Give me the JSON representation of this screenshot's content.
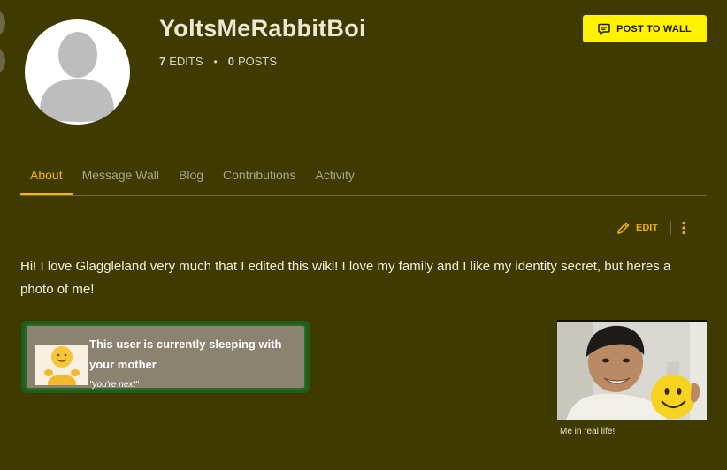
{
  "profile": {
    "username": "YoltsMeRabbitBoi",
    "edits_count": "7",
    "edits_label": "EDITS",
    "posts_count": "0",
    "posts_label": "POSTS",
    "separator": "•"
  },
  "post_button": {
    "label": "POST TO WALL",
    "icon": "speech-bubble-icon"
  },
  "tabs": [
    {
      "label": "About",
      "active": true
    },
    {
      "label": "Message Wall",
      "active": false
    },
    {
      "label": "Blog",
      "active": false
    },
    {
      "label": "Contributions",
      "active": false
    },
    {
      "label": "Activity",
      "active": false
    }
  ],
  "edit_button": {
    "label": "EDIT",
    "icon": "pencil-icon"
  },
  "more_menu": {
    "icon": "more-vertical-icon"
  },
  "bio": "Hi! I love Glaggleland very much that I edited this wiki! I love my family and I like my identity secret, but heres a photo of me!",
  "userbox": {
    "text": "This user is currently sleeping with your mother",
    "quote": "\"you're next\""
  },
  "photo": {
    "caption": "Me in real life!"
  },
  "colors": {
    "background": "#3f3a00",
    "accent": "#f5b400",
    "button_bg": "#fff200",
    "userbox_border": "#1f5e1a",
    "userbox_bg": "#8c8270"
  }
}
